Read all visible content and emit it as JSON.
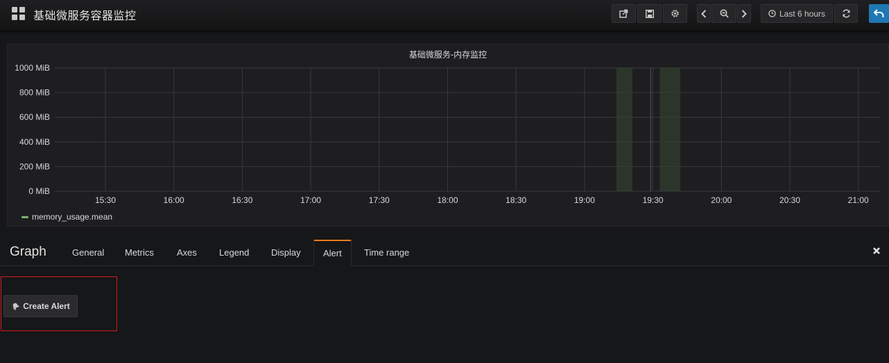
{
  "navbar": {
    "title": "基础微服务容器监控",
    "dashboard_icon": "grid-icon",
    "buttons": [
      {
        "name": "share-button",
        "icon": "share-icon"
      },
      {
        "name": "save-button",
        "icon": "save-icon"
      },
      {
        "name": "settings-button",
        "icon": "gear-icon"
      }
    ],
    "time_nav": {
      "prev_icon": "chevron-left-icon",
      "zoom_icon": "zoom-out-icon",
      "next_icon": "chevron-right-icon"
    },
    "time_range_label": "Last 6 hours",
    "refresh_icon": "refresh-icon",
    "back_icon": "back-arrow-icon"
  },
  "panel": {
    "title": "基础微服务-内存监控",
    "legend": [
      {
        "name": "memory_usage.mean",
        "color": "#7eb26d"
      }
    ]
  },
  "chart_data": {
    "type": "line",
    "title": "基础微服务-内存监控",
    "x_ticks": [
      "15:30",
      "16:00",
      "16:30",
      "17:00",
      "17:30",
      "18:00",
      "18:30",
      "19:00",
      "19:30",
      "20:00",
      "20:30",
      "21:00"
    ],
    "y_ticks": [
      "0 MiB",
      "200 MiB",
      "400 MiB",
      "600 MiB",
      "800 MiB",
      "1000 MiB"
    ],
    "ylim": [
      0,
      1000
    ],
    "y_unit": "MiB",
    "series": [
      {
        "name": "memory_usage.mean",
        "color": "#7eb26d",
        "points": []
      }
    ],
    "shaded_ranges": [
      [
        "19:14",
        "19:21"
      ],
      [
        "19:33",
        "19:42"
      ]
    ],
    "grid": true,
    "legend_position": "bottom-left"
  },
  "editor": {
    "title": "Graph",
    "tabs": [
      "General",
      "Metrics",
      "Axes",
      "Legend",
      "Display",
      "Alert",
      "Time range"
    ],
    "active_tab": "Alert",
    "close_icon": "close-icon",
    "create_alert_label": "Create Alert",
    "create_alert_icon": "bell-icon"
  },
  "colors": {
    "background": "#161719",
    "panel": "#1e1e20",
    "accent_tab": "#eb7b18",
    "highlight": "#d21c1c",
    "primary": "#1f78b4"
  }
}
